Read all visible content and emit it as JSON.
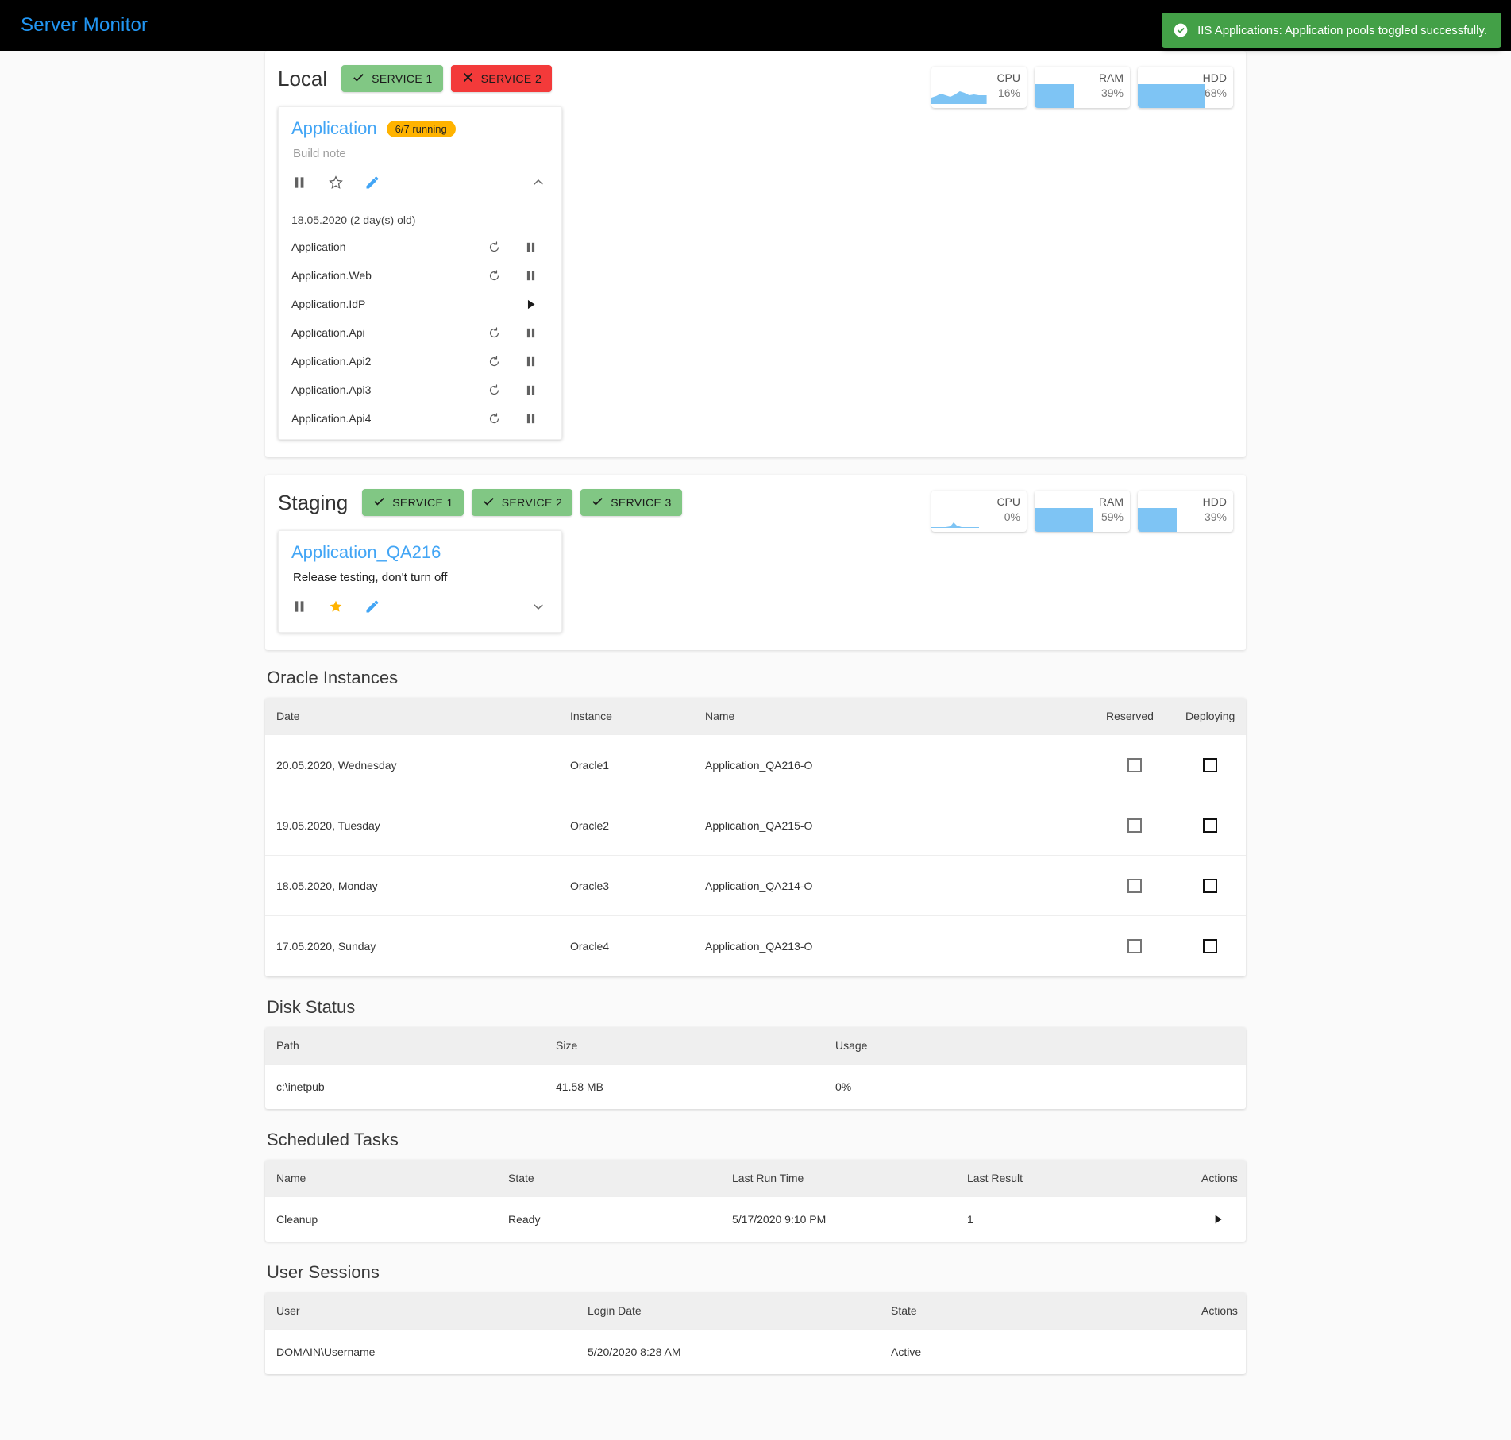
{
  "app": {
    "title": "Server Monitor"
  },
  "toast": {
    "icon": "check-circle-icon",
    "message": "IIS Applications: Application pools toggled successfully."
  },
  "environments": [
    {
      "name": "Local",
      "services": [
        {
          "label": "SERVICE 1",
          "status": "ok"
        },
        {
          "label": "SERVICE 2",
          "status": "bad"
        }
      ],
      "gauges": [
        {
          "label": "CPU",
          "value": "16%",
          "percent": 16,
          "style": "spark"
        },
        {
          "label": "RAM",
          "value": "39%",
          "percent": 39,
          "style": "bar"
        },
        {
          "label": "HDD",
          "value": "68%",
          "percent": 68,
          "style": "bar"
        }
      ],
      "card": {
        "title": "Application",
        "badge": "6/7 running",
        "note_placeholder": "Build note",
        "note_value": "",
        "starred": false,
        "expanded": true,
        "build_date": "18.05.2020 (2 day(s) old)",
        "pools": [
          {
            "name": "Application",
            "running": true
          },
          {
            "name": "Application.Web",
            "running": true
          },
          {
            "name": "Application.IdP",
            "running": false
          },
          {
            "name": "Application.Api",
            "running": true
          },
          {
            "name": "Application.Api2",
            "running": true
          },
          {
            "name": "Application.Api3",
            "running": true
          },
          {
            "name": "Application.Api4",
            "running": true
          }
        ]
      }
    },
    {
      "name": "Staging",
      "services": [
        {
          "label": "SERVICE 1",
          "status": "ok"
        },
        {
          "label": "SERVICE 2",
          "status": "ok"
        },
        {
          "label": "SERVICE 3",
          "status": "ok"
        }
      ],
      "gauges": [
        {
          "label": "CPU",
          "value": "0%",
          "percent": 0,
          "style": "spark"
        },
        {
          "label": "RAM",
          "value": "59%",
          "percent": 59,
          "style": "bar"
        },
        {
          "label": "HDD",
          "value": "39%",
          "percent": 39,
          "style": "bar"
        }
      ],
      "card": {
        "title": "Application_QA216",
        "badge": "",
        "note_placeholder": "Build note",
        "note_value": "Release testing, don't turn off",
        "starred": true,
        "expanded": false,
        "build_date": "",
        "pools": []
      }
    }
  ],
  "oracle": {
    "title": "Oracle Instances",
    "columns": [
      "Date",
      "Instance",
      "Name",
      "Reserved",
      "Deploying"
    ],
    "rows": [
      {
        "date": "20.05.2020, Wednesday",
        "instance": "Oracle1",
        "name": "Application_QA216-O",
        "reserved": false,
        "deploying": false
      },
      {
        "date": "19.05.2020, Tuesday",
        "instance": "Oracle2",
        "name": "Application_QA215-O",
        "reserved": false,
        "deploying": false
      },
      {
        "date": "18.05.2020, Monday",
        "instance": "Oracle3",
        "name": "Application_QA214-O",
        "reserved": false,
        "deploying": false
      },
      {
        "date": "17.05.2020, Sunday",
        "instance": "Oracle4",
        "name": "Application_QA213-O",
        "reserved": false,
        "deploying": false
      }
    ]
  },
  "disk": {
    "title": "Disk Status",
    "columns": [
      "Path",
      "Size",
      "Usage"
    ],
    "rows": [
      {
        "path": "c:\\inetpub",
        "size": "41.58 MB",
        "usage": "0%"
      }
    ]
  },
  "tasks": {
    "title": "Scheduled Tasks",
    "columns": [
      "Name",
      "State",
      "Last Run Time",
      "Last Result",
      "Actions"
    ],
    "rows": [
      {
        "name": "Cleanup",
        "state": "Ready",
        "last_run": "5/17/2020 9:10 PM",
        "last_result": "1",
        "action_icon": "play-icon"
      }
    ]
  },
  "sessions": {
    "title": "User Sessions",
    "columns": [
      "User",
      "Login Date",
      "State",
      "Actions"
    ],
    "rows": [
      {
        "user": "DOMAIN\\Username",
        "login_date": "5/20/2020 8:28 AM",
        "state": "Active"
      }
    ]
  }
}
